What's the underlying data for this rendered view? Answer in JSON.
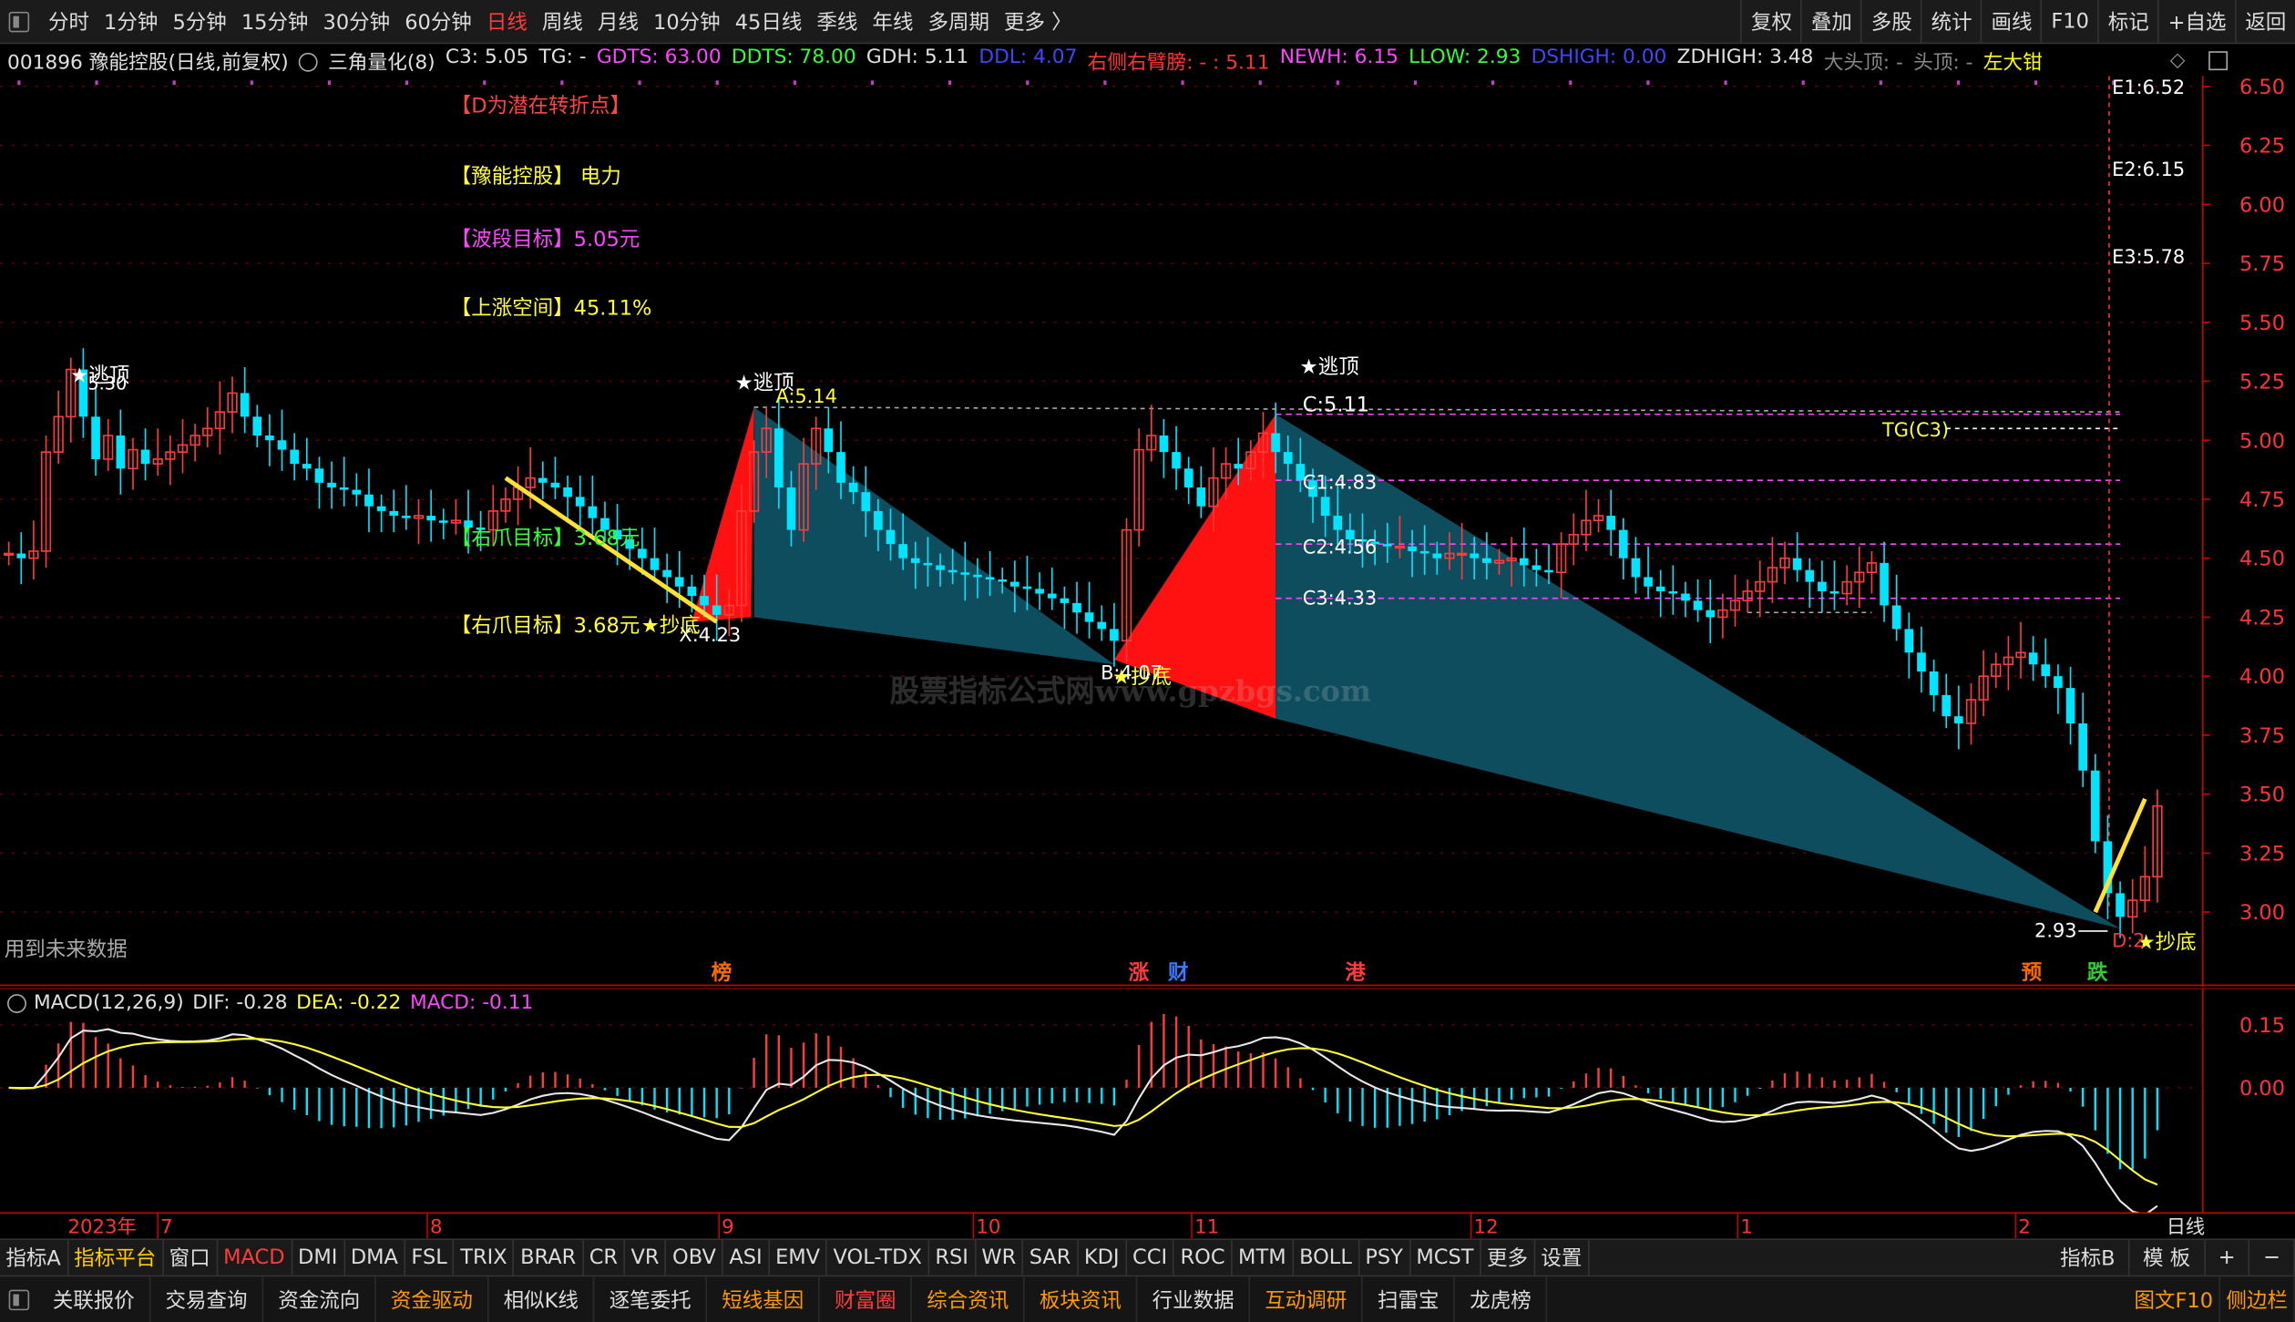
{
  "toolbar": {
    "periods": [
      "分时",
      "1分钟",
      "5分钟",
      "15分钟",
      "30分钟",
      "60分钟",
      "日线",
      "周线",
      "月线",
      "10分钟",
      "45日线",
      "季线",
      "年线",
      "多周期",
      "更多 〉"
    ],
    "active_period": "日线",
    "right_buttons": [
      "复权",
      "叠加",
      "多股",
      "统计",
      "画线",
      "F10",
      "标记",
      "+自选",
      "返回"
    ]
  },
  "info": {
    "code_name": "001896 豫能控股(日线,前复权)",
    "indicator": "三角量化(8)",
    "items": [
      {
        "t": "C3: 5.05",
        "c": "#e0e0e0"
      },
      {
        "t": "TG: -",
        "c": "#e0e0e0"
      },
      {
        "t": "GDTS: 63.00",
        "c": "#ff44ff"
      },
      {
        "t": "DDTS: 78.00",
        "c": "#33ff33"
      },
      {
        "t": "GDH: 5.11",
        "c": "#e0e0e0"
      },
      {
        "t": "DDL: 4.07",
        "c": "#4444ff"
      },
      {
        "t": "右侧右臂膀: - : 5.11",
        "c": "#ff3333"
      },
      {
        "t": "NEWH: 6.15",
        "c": "#ff44ff"
      },
      {
        "t": "LLOW: 2.93",
        "c": "#33ff33"
      },
      {
        "t": "DSHIGH: 0.00",
        "c": "#4444ff"
      },
      {
        "t": "ZDHIGH: 3.48",
        "c": "#e0e0e0"
      },
      {
        "t": "大头顶: -",
        "c": "#888888"
      },
      {
        "t": "头顶: -",
        "c": "#888888"
      },
      {
        "t": "左大钳",
        "c": "#ffff00"
      }
    ]
  },
  "annotations": {
    "d_point": "【D为潜在转折点】",
    "stock": "【豫能控股】",
    "industry": "电力",
    "wave_target": "【波段目标】5.05元",
    "rise_space": "【上涨空间】45.11%",
    "left_claw": "【右爪目标】3.68元",
    "right_claw": "【右爪目标】3.68元",
    "future_data": "用到未来数据",
    "escape_top": "★逃顶",
    "bottom_buy": "★抄底",
    "A": "A:5.14",
    "B": "B:4.07",
    "C": "C:5.11",
    "X": "X:4.23",
    "C1": "C1:4.83",
    "C2": "C2:4.56",
    "C3": "C3:4.33",
    "E1": "E1:6.52",
    "E2": "E2:6.15",
    "E3": "E3:5.78",
    "TG": "TG(C3)",
    "low": "2.93",
    "D": "D:2",
    "left_high": "5.30",
    "watermark": "股票指标公式网www.gpzbgs.com"
  },
  "markers": [
    {
      "t": "榜",
      "c": "#ff6a00"
    },
    {
      "t": "涨",
      "c": "#ff3b3b"
    },
    {
      "t": "财",
      "c": "#3b7bff"
    },
    {
      "t": "港",
      "c": "#ff3b3b"
    },
    {
      "t": "预",
      "c": "#ff6a00"
    },
    {
      "t": "跌",
      "c": "#33cc33"
    }
  ],
  "price_axis": [
    "6.50",
    "6.25",
    "6.00",
    "5.75",
    "5.50",
    "5.25",
    "5.00",
    "4.75",
    "4.50",
    "4.25",
    "4.00",
    "3.75",
    "3.50",
    "3.25",
    "3.00"
  ],
  "macd": {
    "title": "MACD(12,26,9)",
    "dif": "DIF: -0.28",
    "dea": "DEA: -0.22",
    "macd": "MACD: -0.11",
    "axis": [
      "0.15",
      "0.00"
    ]
  },
  "time_axis": {
    "year": "2023年",
    "months": [
      "7",
      "8",
      "9",
      "10",
      "11",
      "12",
      "1",
      "2"
    ],
    "period": "日线"
  },
  "indicator_tabs": [
    "指标A",
    "指标平台",
    "窗口",
    "MACD",
    "DMI",
    "DMA",
    "FSL",
    "TRIX",
    "BRAR",
    "CR",
    "VR",
    "OBV",
    "ASI",
    "EMV",
    "VOL-TDX",
    "RSI",
    "WR",
    "SAR",
    "KDJ",
    "CCI",
    "ROC",
    "MTM",
    "BOLL",
    "PSY",
    "MCST",
    "更多",
    "设置"
  ],
  "indicator_right": [
    "指标B",
    "模 板",
    "+",
    "−"
  ],
  "bottom_tabs": [
    {
      "t": "关联报价",
      "c": "#dddddd"
    },
    {
      "t": "交易查询",
      "c": "#dddddd"
    },
    {
      "t": "资金流向",
      "c": "#dddddd"
    },
    {
      "t": "资金驱动",
      "c": "#ff9900"
    },
    {
      "t": "相似K线",
      "c": "#dddddd"
    },
    {
      "t": "逐笔委托",
      "c": "#dddddd"
    },
    {
      "t": "短线基因",
      "c": "#ff9900"
    },
    {
      "t": "财富圈",
      "c": "#ff3b3b"
    },
    {
      "t": "综合资讯",
      "c": "#ff9900"
    },
    {
      "t": "板块资讯",
      "c": "#ff9900"
    },
    {
      "t": "行业数据",
      "c": "#dddddd"
    },
    {
      "t": "互动调研",
      "c": "#ff9900"
    },
    {
      "t": "扫雷宝",
      "c": "#dddddd"
    },
    {
      "t": "龙虎榜",
      "c": "#dddddd"
    }
  ],
  "bottom_right": [
    "图文F10",
    "侧边栏"
  ],
  "chart_data": {
    "type": "candlestick",
    "price_range": [
      2.8,
      6.6
    ],
    "closes": [
      4.52,
      4.5,
      4.53,
      4.95,
      5.1,
      5.3,
      5.1,
      4.92,
      5.02,
      4.88,
      4.96,
      4.9,
      4.92,
      4.95,
      4.98,
      5.02,
      5.05,
      5.12,
      5.2,
      5.1,
      5.02,
      5.0,
      4.96,
      4.9,
      4.88,
      4.82,
      4.8,
      4.79,
      4.77,
      4.72,
      4.7,
      4.68,
      4.67,
      4.68,
      4.66,
      4.65,
      4.66,
      4.63,
      4.62,
      4.7,
      4.75,
      4.8,
      4.84,
      4.82,
      4.8,
      4.76,
      4.72,
      4.67,
      4.62,
      4.58,
      4.54,
      4.5,
      4.45,
      4.42,
      4.38,
      4.34,
      4.3,
      4.26,
      4.3,
      4.7,
      4.95,
      5.05,
      4.8,
      4.62,
      4.9,
      5.05,
      4.95,
      4.82,
      4.78,
      4.7,
      4.62,
      4.56,
      4.5,
      4.48,
      4.47,
      4.45,
      4.44,
      4.43,
      4.42,
      4.41,
      4.4,
      4.38,
      4.37,
      4.35,
      4.33,
      4.31,
      4.27,
      4.23,
      4.2,
      4.15,
      4.62,
      4.96,
      5.02,
      4.95,
      4.88,
      4.8,
      4.72,
      4.84,
      4.9,
      4.88,
      4.95,
      5.03,
      4.95,
      4.9,
      4.83,
      4.76,
      4.68,
      4.62,
      4.58,
      4.57,
      4.56,
      4.55,
      4.55,
      4.53,
      4.52,
      4.5,
      4.52,
      4.52,
      4.5,
      4.48,
      4.49,
      4.5,
      4.47,
      4.45,
      4.44,
      4.56,
      4.6,
      4.66,
      4.68,
      4.62,
      4.5,
      4.42,
      4.38,
      4.36,
      4.35,
      4.32,
      4.28,
      4.25,
      4.28,
      4.32,
      4.36,
      4.4,
      4.46,
      4.5,
      4.45,
      4.4,
      4.36,
      4.35,
      4.4,
      4.44,
      4.48,
      4.3,
      4.2,
      4.1,
      4.02,
      3.92,
      3.83,
      3.8,
      3.9,
      4.0,
      4.05,
      4.08,
      4.1,
      4.05,
      4.0,
      3.95,
      3.8,
      3.6,
      3.3,
      3.08,
      2.98,
      3.05,
      3.15,
      3.45
    ]
  }
}
